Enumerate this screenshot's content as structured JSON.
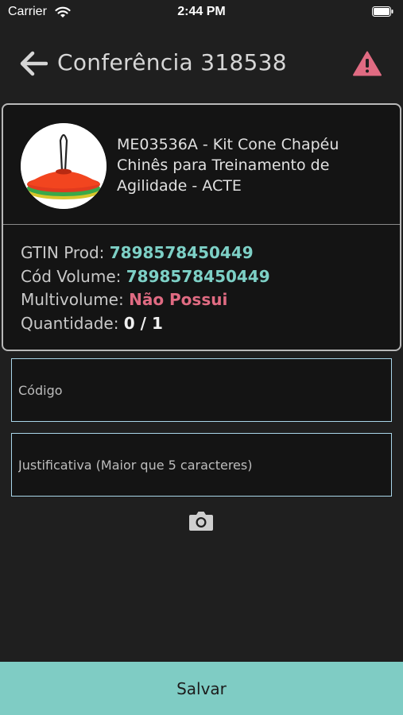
{
  "status_bar": {
    "carrier": "Carrier",
    "time": "2:44 PM"
  },
  "header": {
    "back_icon": "arrow-left-icon",
    "title": "Conferência 318538",
    "warning_icon": "warning-triangle-icon"
  },
  "product": {
    "name": "ME03536A - Kit Cone Chapéu Chinês para Treinamento de Agilidade - ACTE",
    "details": [
      {
        "label": "GTIN Prod: ",
        "value": "7898578450449"
      },
      {
        "label": "Cód Volume: ",
        "value": "7898578450449"
      },
      {
        "label": "Multivolume: ",
        "value": "Não Possui"
      },
      {
        "label": "Quantidade: ",
        "value": "0 / 1"
      }
    ]
  },
  "form": {
    "codigo_placeholder": "Código",
    "justificativa_placeholder": "Justificativa (Maior que 5 caracteres)",
    "camera_icon": "camera-icon"
  },
  "footer": {
    "save_label": "Salvar"
  },
  "colors": {
    "background": "#1f1f1f",
    "accent": "#7fccc4",
    "teal_value": "#7dd0c6",
    "red_value": "#e06b82",
    "warning": "#e06b82"
  }
}
